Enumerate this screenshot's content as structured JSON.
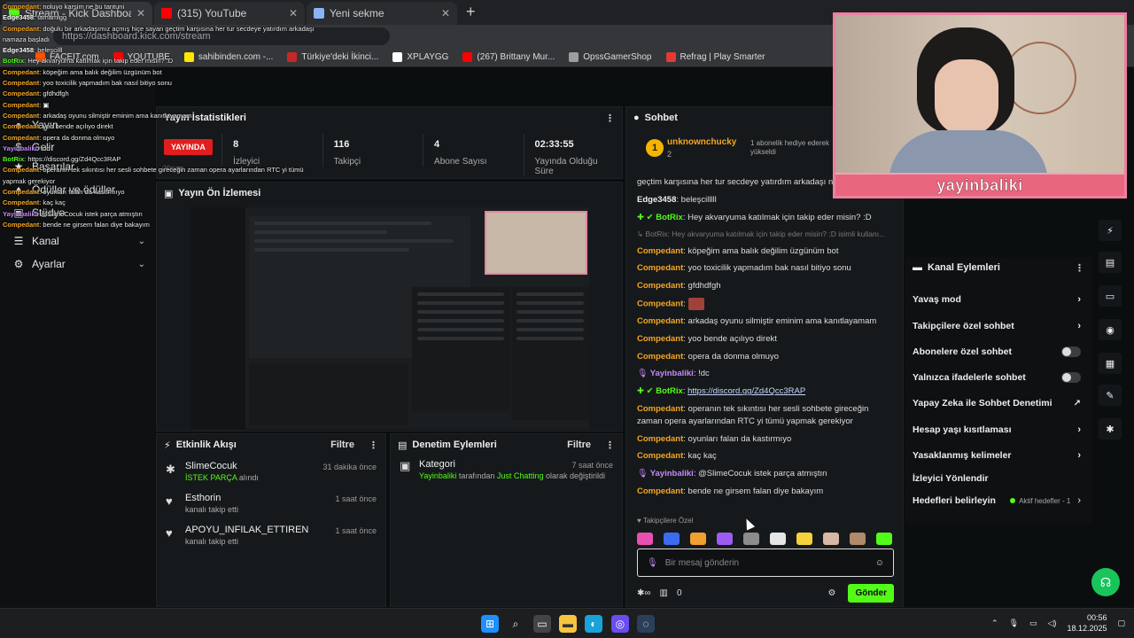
{
  "browser": {
    "tabs": [
      {
        "label": "Stream - Kick Dashboard",
        "close": "✕",
        "color": "#53fc18"
      },
      {
        "label": "(315) YouTube",
        "close": "✕",
        "color": "#ff0000"
      },
      {
        "label": "Yeni sekme",
        "close": "✕",
        "color": "#8ab4f8"
      }
    ],
    "new_tab": "+",
    "address": "https://dashboard.kick.com/stream",
    "bookmarks": [
      {
        "label": "FACEIT.com",
        "color": "#ff5500"
      },
      {
        "label": "YOUTUBE",
        "color": "#ff0000"
      },
      {
        "label": "sahibinden.com -...",
        "color": "#ffe600"
      },
      {
        "label": "Türkiye'deki İkinci...",
        "color": "#c62828"
      },
      {
        "label": "XPLAYGG",
        "color": "#ffffff"
      },
      {
        "label": "(267) Brittany Mur...",
        "color": "#ff0000"
      },
      {
        "label": "OpssGamerShop",
        "color": "#9e9e9e"
      },
      {
        "label": "Refrag | Play Smarter",
        "color": "#e53935"
      }
    ]
  },
  "overlay_chat": [
    {
      "user": "Compedant",
      "text": "noluyo karşim ne bu tantuni",
      "kind": "c"
    },
    {
      "user": "Edge3458",
      "text": "tamamlgg",
      "kind": "e"
    },
    {
      "user": "Compedant",
      "text": "doğulu bir arkadaşımız açmış hiçe sayan geçtim karşısına her tur secdeye yatırdım arkadaşı namaza başladı",
      "kind": "c"
    },
    {
      "user": "Edge3458",
      "text": "beleşcilll",
      "kind": "e"
    },
    {
      "user": "BotRix",
      "text": "Hey akvaryuma katılmak için takip eder misin? :D",
      "kind": "b"
    },
    {
      "user": "Compedant",
      "text": "köpeğim ama balık değilim üzgünüm bot",
      "kind": "c"
    },
    {
      "user": "Compedant",
      "text": "yoo toxicilik yapmadım bak nasıl bitiyo sonu",
      "kind": "c"
    },
    {
      "user": "Compedant",
      "text": "gfdhdfgh",
      "kind": "c"
    },
    {
      "user": "Compedant",
      "text": "▣",
      "kind": "c"
    },
    {
      "user": "Compedant",
      "text": "arkadaş oyunu silmiştir eminim ama kanıtlayamam",
      "kind": "c"
    },
    {
      "user": "Compedant",
      "text": "yoo bende açılıyo direkt",
      "kind": "c"
    },
    {
      "user": "Compedant",
      "text": "opera da donma olmuyo",
      "kind": "c"
    },
    {
      "user": "Yayinbaliki",
      "text": "!dc",
      "kind": "y"
    },
    {
      "user": "BotRix",
      "text": "https://discord.gg/Zd4Qcc3RAP",
      "kind": "b"
    },
    {
      "user": "Compedant",
      "text": "operanın tek sıkıntısı her sesli sohbete gireceğin zaman opera ayarlarından RTC yi tümü yapmak gerekiyor",
      "kind": "c"
    },
    {
      "user": "Compedant",
      "text": "oyunları falan da kastırmıyo",
      "kind": "c"
    },
    {
      "user": "Compedant",
      "text": "kaç kaç",
      "kind": "c"
    },
    {
      "user": "Yayinbaliki",
      "text": "@SlimeCocuk istek parça atmıştın",
      "kind": "y"
    },
    {
      "user": "Compedant",
      "text": "bende ne girsem falan diye bakayım",
      "kind": "c"
    }
  ],
  "nav": {
    "items": [
      {
        "label": "Yayın",
        "icon": "●"
      },
      {
        "label": "Gelir",
        "icon": "$"
      },
      {
        "label": "Başarılar",
        "icon": "★"
      },
      {
        "label": "Ödüller ve ödüller",
        "icon": "♦"
      },
      {
        "label": "Stüdyo",
        "icon": "▣"
      },
      {
        "label": "Kanal",
        "icon": "☰",
        "chev": "⌄"
      },
      {
        "label": "Ayarlar",
        "icon": "⚙",
        "chev": "⌄"
      }
    ]
  },
  "stats": {
    "title": "Yayın İstatistikleri",
    "live_badge": "YAYINDA",
    "live_sub": "Yayın",
    "items": [
      {
        "value": "8",
        "label": "İzleyici"
      },
      {
        "value": "116",
        "label": "Takipçi"
      },
      {
        "value": "4",
        "label": "Abone Sayısı"
      },
      {
        "value": "02:33:55",
        "label": "Yayında Olduğu Süre"
      }
    ]
  },
  "preview": {
    "title": "Yayın Ön İzlemesi"
  },
  "activity": {
    "title": "Etkinlik Akışı",
    "filter": "Filtre",
    "events": [
      {
        "name": "SlimeCocuk",
        "desc_green": "İSTEK PARÇA",
        "desc": "alındı",
        "time": "31 dakika önce",
        "icon": "✱"
      },
      {
        "name": "Esthorin",
        "desc_green": "",
        "desc": "kanalı takip etti",
        "time": "1 saat önce",
        "icon": "♥"
      },
      {
        "name": "APOYU_INFILAK_ETTIREN",
        "desc_green": "",
        "desc": "kanalı takip etti",
        "time": "1 saat önce",
        "icon": "♥"
      }
    ]
  },
  "moderation": {
    "title": "Denetim Eylemleri",
    "filter": "Filtre",
    "events": [
      {
        "name": "Kategori",
        "user": "Yayinbaliki",
        "mid": "tarafından",
        "cat": "Just Chatting",
        "tail": "olarak değiştirildi",
        "time": "7 saat önce"
      }
    ]
  },
  "chat": {
    "title": "Sohbet",
    "pinned_user": "unknownchucky",
    "pinned_count": "2",
    "pinned_text": "1 abonelik hediye ederek yükseldi",
    "messages": [
      {
        "user": "",
        "text": "geçtim karşısına her tur secdeye yatırdım arkadaşı namaza başladı",
        "kind": "cont"
      },
      {
        "user": "Edge3458",
        "text": "beleşcilllll",
        "kind": "edge"
      },
      {
        "user": "BotRix",
        "text": "Hey akvaryuma katılmak için takip eder misin? :D",
        "kind": "bot"
      },
      {
        "user": "",
        "text": "↳ BotRix: Hey akvaryuma katılmak için takip eder misin? :D isimli kullanı...",
        "kind": "small"
      },
      {
        "user": "Compedant",
        "text": "köpeğim ama balık değilim üzgünüm bot",
        "kind": "c"
      },
      {
        "user": "Compedant",
        "text": "yoo toxicilik yapmadım bak nasıl bitiyo sonu",
        "kind": "c"
      },
      {
        "user": "Compedant",
        "text": "gfdhdfgh",
        "kind": "c"
      },
      {
        "user": "Compedant",
        "text": "",
        "kind": "emote"
      },
      {
        "user": "Compedant",
        "text": "arkadaş oyunu silmiştir eminim ama kanıtlayamam",
        "kind": "c"
      },
      {
        "user": "Compedant",
        "text": "yoo bende açılıyo direkt",
        "kind": "c"
      },
      {
        "user": "Compedant",
        "text": "opera da donma olmuyo",
        "kind": "c"
      },
      {
        "user": "Yayinbaliki",
        "text": "!dc",
        "kind": "yb"
      },
      {
        "user": "BotRix",
        "text": "https://discord.gg/Zd4Qcc3RAP",
        "kind": "botlink"
      },
      {
        "user": "Compedant",
        "text": "operanın tek sıkıntısı her sesli sohbete gireceğin zaman opera ayarlarından RTC yi tümü yapmak gerekiyor",
        "kind": "c"
      },
      {
        "user": "Compedant",
        "text": "oyunları falan da kastırmıyo",
        "kind": "c"
      },
      {
        "user": "Compedant",
        "text": "kaç kaç",
        "kind": "c"
      },
      {
        "user": "Yayinbaliki",
        "text": "@SlimeCocuk istek parça atmıştın",
        "kind": "yb"
      },
      {
        "user": "Compedant",
        "text": "bende ne girsem falan diye bakayım",
        "kind": "c"
      }
    ],
    "emote_label": "Takipçilere Özel",
    "emote_colors": [
      "#e94fb0",
      "#3b6cf0",
      "#f0a030",
      "#9d5cf0",
      "#8c8c8c",
      "#e6e6e6",
      "#f5d13b",
      "#d7b7a6",
      "#b08a6a",
      "#53fc18"
    ],
    "placeholder": "Bir mesaj gönderin",
    "footer_count": "0",
    "send_label": "Gönder"
  },
  "channel_actions": {
    "title": "Kanal Eylemleri",
    "items": [
      {
        "label": "Yavaş mod",
        "ctrl": "chev"
      },
      {
        "label": "Takipçilere özel sohbet",
        "ctrl": "chev"
      },
      {
        "label": "Abonelere özel sohbet",
        "ctrl": "toggle"
      },
      {
        "label": "Yalnızca ifadelerle sohbet",
        "ctrl": "toggle"
      },
      {
        "label": "Yapay Zeka ile Sohbet Denetimi",
        "ctrl": "ext"
      },
      {
        "label": "Hesap yaşı kısıtlaması",
        "ctrl": "chev"
      },
      {
        "label": "Yasaklanmış kelimeler",
        "ctrl": "chev"
      },
      {
        "label": "İzleyici Yönlendir",
        "ctrl": "none"
      },
      {
        "label": "Hedefleri belirleyin",
        "ctrl": "aktif"
      }
    ],
    "aktif_label": "Aktif hedefler - 1"
  },
  "webcam": {
    "banner": "yayinbaliki"
  },
  "taskbar": {
    "time": "00:56",
    "date": "18.12.2025"
  },
  "colors": {
    "accent": "#53fc18",
    "live": "#e01e1e",
    "bg": "#0b0e0f",
    "panel": "#16191b",
    "cam_border": "#ee7fa0"
  }
}
